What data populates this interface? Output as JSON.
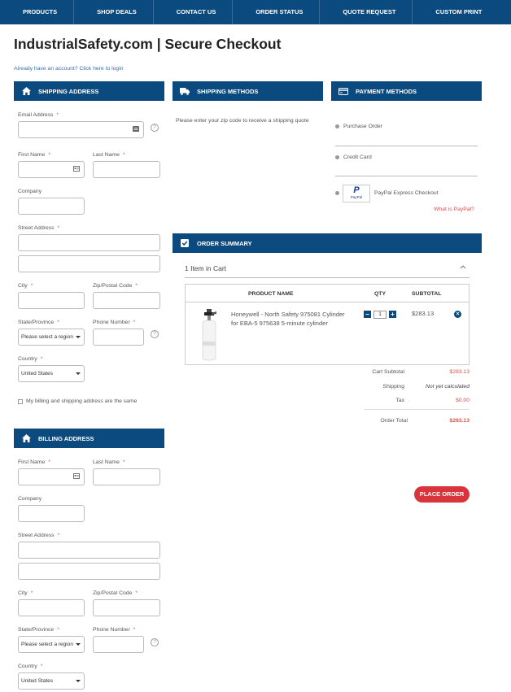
{
  "nav": [
    "PRODUCTS",
    "SHOP DEALS",
    "CONTACT US",
    "ORDER STATUS",
    "QUOTE REQUEST",
    "CUSTOM PRINT"
  ],
  "page_title": "IndustrialSafety.com | Secure Checkout",
  "login_link": "Already have an account? Click here to login",
  "shipping_address": {
    "title": "SHIPPING ADDRESS",
    "email": "Email Address",
    "first_name": "First Name",
    "last_name": "Last Name",
    "company": "Company",
    "street": "Street Address",
    "city": "City",
    "zip": "Zip/Postal Code",
    "state": "State/Province",
    "state_value": "Please select a region",
    "phone": "Phone Number",
    "country": "Country",
    "country_value": "United States",
    "same_address": "My billing and shipping address are the same"
  },
  "billing_address": {
    "title": "BILLING ADDRESS",
    "first_name": "First Name",
    "last_name": "Last Name",
    "company": "Company",
    "street": "Street Address",
    "city": "City",
    "zip": "Zip/Postal Code",
    "state": "State/Province",
    "state_value": "Please select a region",
    "phone": "Phone Number",
    "country": "Country",
    "country_value": "United States"
  },
  "required_mark": "*",
  "help_mark": "?",
  "shipping_methods": {
    "title": "SHIPPING METHODS",
    "message": "Please enter your zip code to receive a shipping quote"
  },
  "payment_methods": {
    "title": "PAYMENT METHODS",
    "options": [
      "Purchase Order",
      "Credit Card",
      "PayPal Express Checkout"
    ],
    "paypal_logo": "P",
    "paypal_logo_text": "PayPal",
    "what_is_paypal": "What is PayPal?"
  },
  "order_summary": {
    "title": "ORDER SUMMARY",
    "items_in_cart": "1 Item in Cart",
    "columns": [
      "PRODUCT NAME",
      "QTY",
      "SUBTOTAL"
    ],
    "product_name": "Honeywell - North Safety 975081 Cylinder for EBA-5 975638 5-minute cylinder",
    "qty": "1",
    "subtotal": "$283.13",
    "cart_subtotal_label": "Cart Subtotal",
    "cart_subtotal": "$283.13",
    "shipping_label": "Shipping",
    "shipping": "Not yet calculated",
    "tax_label": "Tax",
    "tax": "$0.00",
    "order_total_label": "Order Total",
    "order_total": "$283.13",
    "place_order": "PLACE ORDER",
    "minus": "−",
    "plus": "+",
    "remove": "×"
  },
  "colors": {
    "brand": "#0a4a7e",
    "accent": "#d9343b"
  }
}
